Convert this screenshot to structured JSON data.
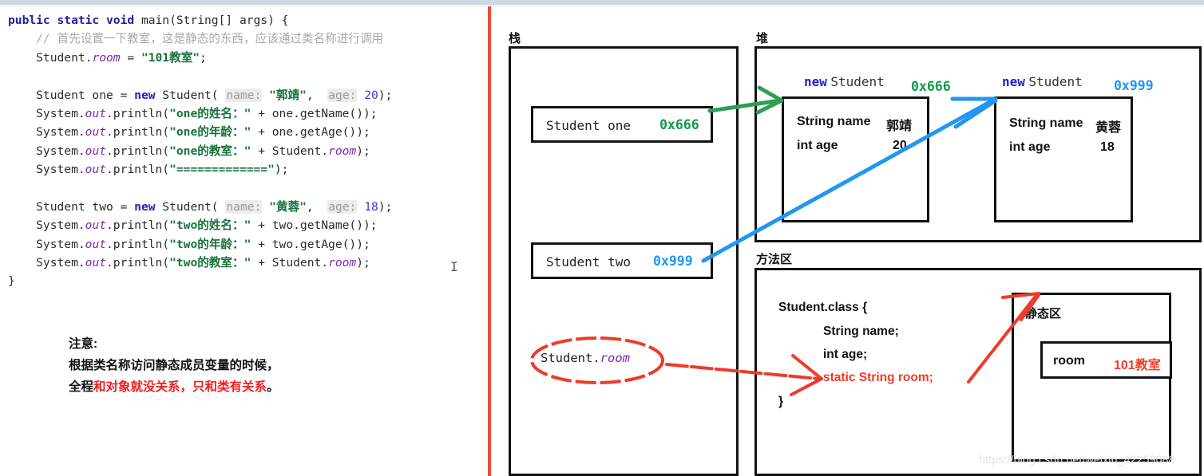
{
  "editor": {
    "code_lines": [
      [
        {
          "t": "public static void ",
          "c": "kw"
        },
        {
          "t": "main(String[] args) {",
          "c": "plain"
        }
      ],
      [
        {
          "t": "    // 首先设置一下教室，这是静态的东西，应该通过类名称进行调用",
          "c": "cmt"
        }
      ],
      [
        {
          "t": "    Student.",
          "c": "plain"
        },
        {
          "t": "room",
          "c": "fld"
        },
        {
          "t": " = ",
          "c": "plain"
        },
        {
          "t": "\"101教室\"",
          "c": "str"
        },
        {
          "t": ";",
          "c": "plain"
        }
      ],
      [],
      [
        {
          "t": "    Student one = ",
          "c": "plain"
        },
        {
          "t": "new",
          "c": "kw2"
        },
        {
          "t": " Student( ",
          "c": "plain"
        },
        {
          "t": "name:",
          "c": "hint"
        },
        {
          "t": " ",
          "c": "plain"
        },
        {
          "t": "\"郭靖\"",
          "c": "str"
        },
        {
          "t": ",  ",
          "c": "plain"
        },
        {
          "t": "age:",
          "c": "hint"
        },
        {
          "t": " ",
          "c": "plain"
        },
        {
          "t": "20",
          "c": "num"
        },
        {
          "t": ");",
          "c": "plain"
        }
      ],
      [
        {
          "t": "    System.",
          "c": "plain"
        },
        {
          "t": "out",
          "c": "fld"
        },
        {
          "t": ".println(",
          "c": "plain"
        },
        {
          "t": "\"one的姓名：\"",
          "c": "str"
        },
        {
          "t": " + one.getName());",
          "c": "plain"
        }
      ],
      [
        {
          "t": "    System.",
          "c": "plain"
        },
        {
          "t": "out",
          "c": "fld"
        },
        {
          "t": ".println(",
          "c": "plain"
        },
        {
          "t": "\"one的年龄：\"",
          "c": "str"
        },
        {
          "t": " + one.getAge());",
          "c": "plain"
        }
      ],
      [
        {
          "t": "    System.",
          "c": "plain"
        },
        {
          "t": "out",
          "c": "fld"
        },
        {
          "t": ".println(",
          "c": "plain"
        },
        {
          "t": "\"one的教室：\"",
          "c": "str"
        },
        {
          "t": " + Student.",
          "c": "plain"
        },
        {
          "t": "room",
          "c": "fld"
        },
        {
          "t": ");",
          "c": "plain"
        }
      ],
      [
        {
          "t": "    System.",
          "c": "plain"
        },
        {
          "t": "out",
          "c": "fld"
        },
        {
          "t": ".println(",
          "c": "plain"
        },
        {
          "t": "\"=============\"",
          "c": "str"
        },
        {
          "t": ");",
          "c": "plain"
        }
      ],
      [],
      [
        {
          "t": "    Student two = ",
          "c": "plain"
        },
        {
          "t": "new",
          "c": "kw2"
        },
        {
          "t": " Student( ",
          "c": "plain"
        },
        {
          "t": "name:",
          "c": "hint"
        },
        {
          "t": " ",
          "c": "plain"
        },
        {
          "t": "\"黄蓉\"",
          "c": "str"
        },
        {
          "t": ",  ",
          "c": "plain"
        },
        {
          "t": "age:",
          "c": "hint"
        },
        {
          "t": " ",
          "c": "plain"
        },
        {
          "t": "18",
          "c": "num"
        },
        {
          "t": ");",
          "c": "plain"
        }
      ],
      [
        {
          "t": "    System.",
          "c": "plain"
        },
        {
          "t": "out",
          "c": "fld"
        },
        {
          "t": ".println(",
          "c": "plain"
        },
        {
          "t": "\"two的姓名：\"",
          "c": "str"
        },
        {
          "t": " + two.getName());",
          "c": "plain"
        }
      ],
      [
        {
          "t": "    System.",
          "c": "plain"
        },
        {
          "t": "out",
          "c": "fld"
        },
        {
          "t": ".println(",
          "c": "plain"
        },
        {
          "t": "\"two的年龄：\"",
          "c": "str"
        },
        {
          "t": " + two.getAge());",
          "c": "plain"
        }
      ],
      [
        {
          "t": "    System.",
          "c": "plain"
        },
        {
          "t": "out",
          "c": "fld"
        },
        {
          "t": ".println(",
          "c": "plain"
        },
        {
          "t": "\"two的教室：\"",
          "c": "str"
        },
        {
          "t": " + Student.",
          "c": "plain"
        },
        {
          "t": "room",
          "c": "fld"
        },
        {
          "t": ");",
          "c": "plain"
        }
      ],
      [
        {
          "t": "}",
          "c": "plain"
        }
      ]
    ],
    "caret_glyph": "I"
  },
  "note": {
    "line1": "注意:",
    "line2": "根据类名称访问静态成员变量的时候，",
    "line3_black_prefix": "全程",
    "line3_red": "和对象就没关系，只和类有关系",
    "line3_black_suffix": "。"
  },
  "diagram": {
    "stack": {
      "label": "栈",
      "frames": [
        {
          "name": "Student one",
          "address": "0x666",
          "addr_color": "#0f9b4a"
        },
        {
          "name": "Student two",
          "address": "0x999",
          "addr_color": "#2196f3"
        }
      ],
      "static_ref": {
        "prefix": "Student.",
        "field": "room"
      }
    },
    "heap": {
      "label": "堆",
      "objects": [
        {
          "new_kw": "new",
          "class_name": "Student",
          "address": "0x666",
          "addr_color": "#0f9b4a",
          "fields": [
            {
              "decl": "String name",
              "value": "郭靖"
            },
            {
              "decl": "int age",
              "value": "20"
            }
          ]
        },
        {
          "new_kw": "new",
          "class_name": "Student",
          "address": "0x999",
          "addr_color": "#2196f3",
          "fields": [
            {
              "decl": "String name",
              "value": "黄蓉"
            },
            {
              "decl": "int age",
              "value": "18"
            }
          ]
        }
      ]
    },
    "method_area": {
      "label": "方法区",
      "class_lines": [
        {
          "text": "Student.class {",
          "color": "black"
        },
        {
          "text": "String name;",
          "color": "black"
        },
        {
          "text": "int age;",
          "color": "black"
        },
        {
          "text": "static String room;",
          "color": "red"
        },
        {
          "text": "}",
          "color": "black"
        }
      ],
      "static_area": {
        "label": "静态区",
        "entry_key": "room",
        "entry_value": "101教室"
      }
    },
    "arrow_colors": {
      "one_to_heap": "#2e9e54",
      "two_to_heap": "#2196f3",
      "static_ref": "#ee3b28"
    }
  },
  "watermark": "https://blog.csdn.net/weixin_42259088"
}
